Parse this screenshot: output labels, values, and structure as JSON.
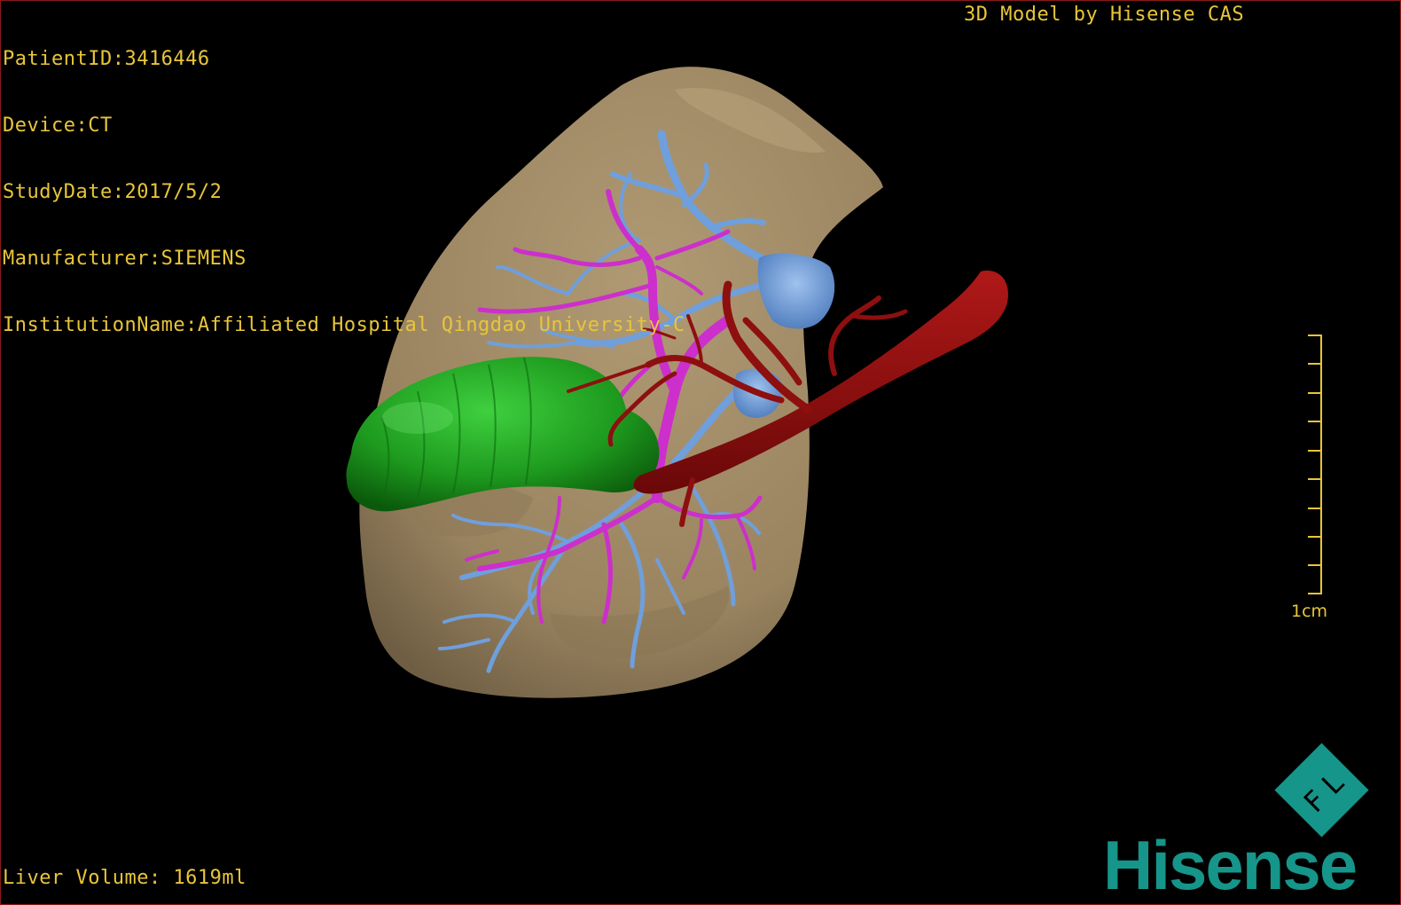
{
  "window": {
    "title": "3D Model by Hisense CAS"
  },
  "study_info": {
    "patient_id": "PatientID:3416446",
    "device": "Device:CT",
    "study_date": "StudyDate:2017/5/2",
    "manufacturer": "Manufacturer:SIEMENS",
    "institution": "InstitutionName:Affiliated Hospital Qingdao University-C"
  },
  "credit": "3D Model by Hisense CAS",
  "liver_volume": "Liver Volume: 1619ml",
  "scale": {
    "label": "1cm"
  },
  "logo": {
    "badge_text": "F L",
    "brand": "Hisense"
  },
  "colors": {
    "overlay_text": "#e8c53a",
    "liver": "#a08a66",
    "tumor": "#1f9b1f",
    "artery": "#8e0f0f",
    "portal_vein": "#cc2fcc",
    "hepatic_vein": "#6f9fdc",
    "brand": "#16958a",
    "frame": "#8b1a1a"
  },
  "model_structures": {
    "liver": "liver-surface",
    "tumor": "tumor-mass",
    "artery": "hepatic-artery",
    "portal": "portal-vein",
    "hepatic_vein": "hepatic-vein"
  }
}
